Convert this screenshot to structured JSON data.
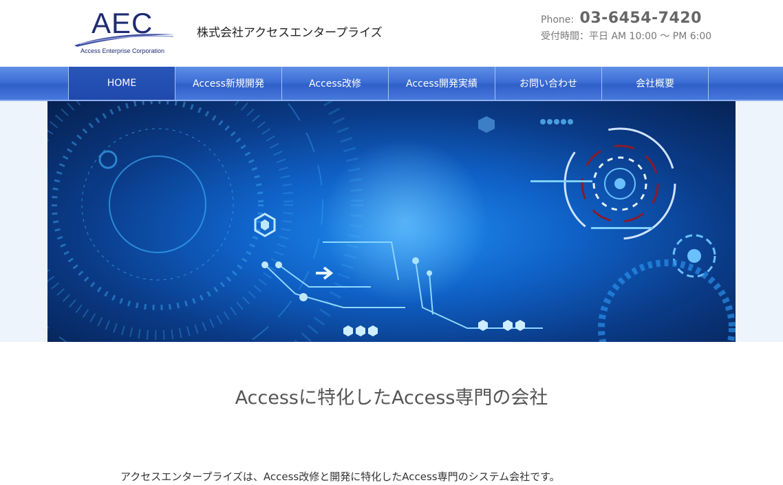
{
  "header": {
    "logo_text": "AEC",
    "logo_subtitle": "Access Enterprise Corporation",
    "company_name": "株式会社アクセスエンタープライズ",
    "phone_label": "Phone:",
    "phone_number": "03-6454-7420",
    "hours": "受付時間：平日 AM 10:00 ～ PM 6:00"
  },
  "nav": {
    "items": [
      {
        "label": "HOME",
        "active": true
      },
      {
        "label": "Access新規開発"
      },
      {
        "label": "Access改修"
      },
      {
        "label": "Access開発実績"
      },
      {
        "label": "お問い合わせ"
      },
      {
        "label": "会社概要"
      }
    ]
  },
  "hero": {
    "image": "blue-technology-circuit-banner"
  },
  "main": {
    "title": "Accessに特化したAccess専門の会社",
    "intro": "アクセスエンタープライズは、Access改修と開発に特化したAccess専門のシステム会社です。"
  },
  "colors": {
    "brand_navy": "#1d2a73",
    "nav_blue": "#3d6fd6",
    "nav_active": "#2350b3",
    "hero_blue": "#1f8df0"
  }
}
